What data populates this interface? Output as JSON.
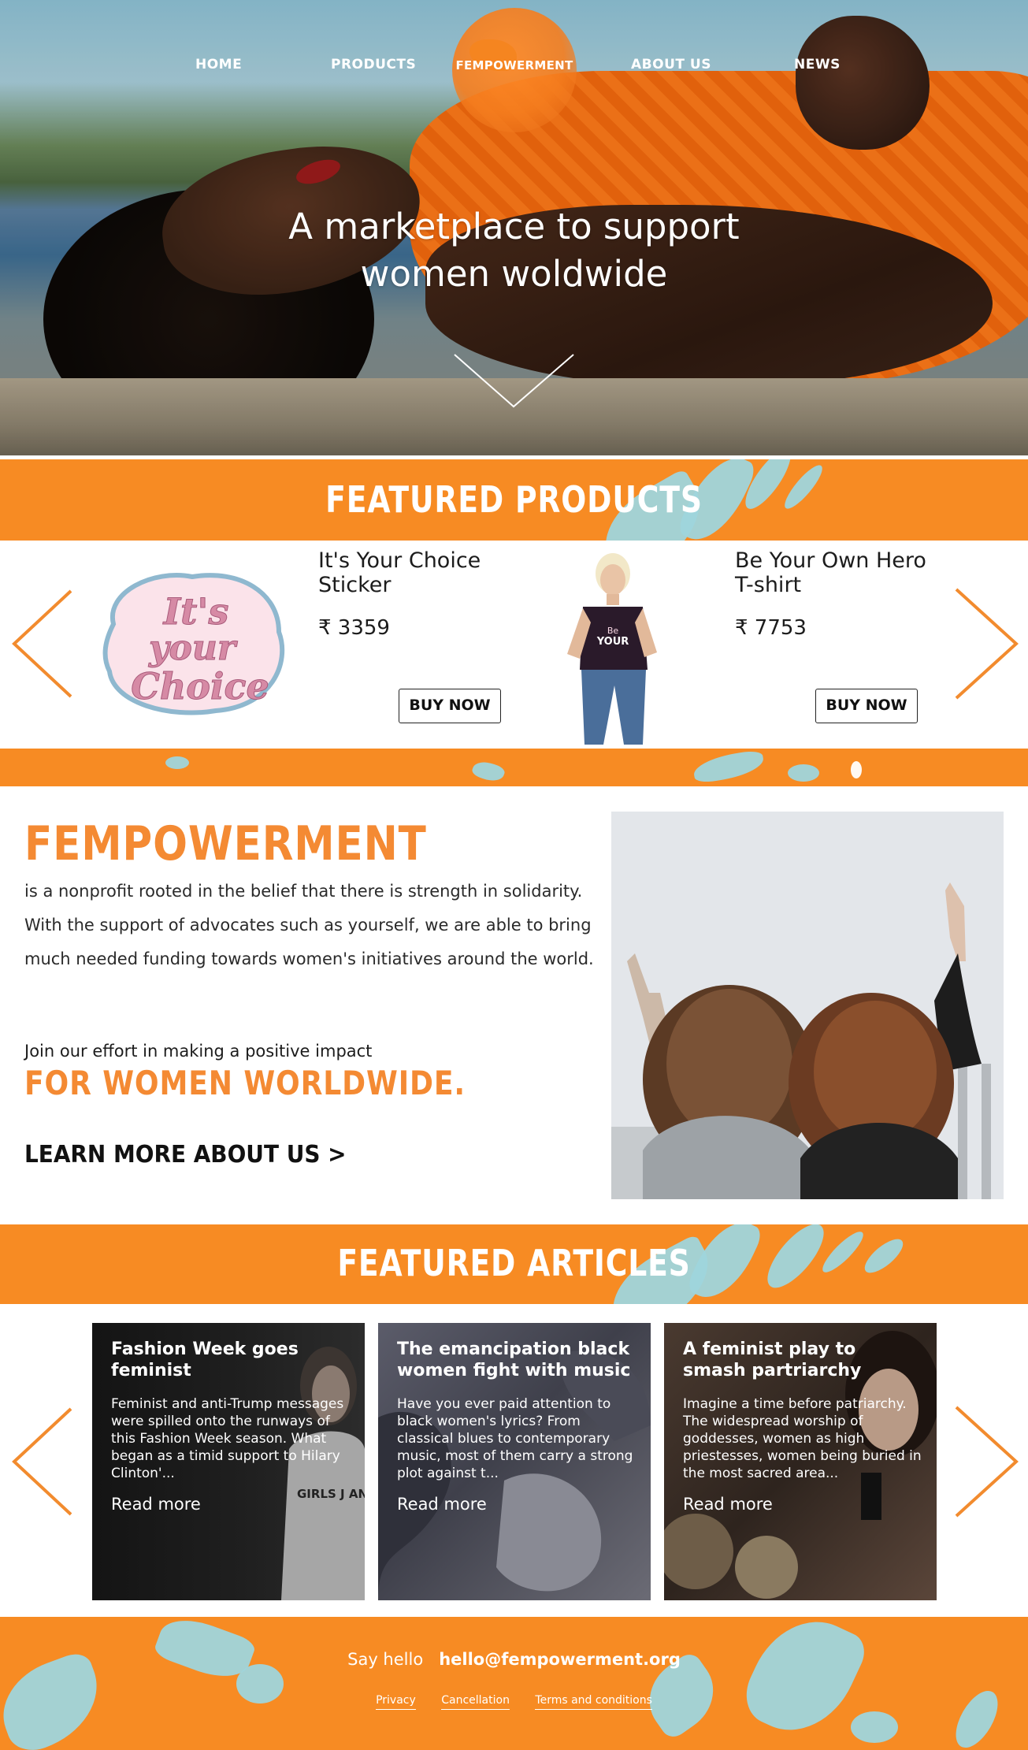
{
  "nav": {
    "home": "HOME",
    "products": "PRODUCTS",
    "logo": "FEMPOWERMENT",
    "about": "ABOUT US",
    "news": "NEWS"
  },
  "hero": {
    "title_line1": "A marketplace to support",
    "title_line2": "women woldwide"
  },
  "featured_products": {
    "title": "FEATURED PRODUCTS",
    "items": [
      {
        "name_line1": "It's Your Choice",
        "name_line2": "Sticker",
        "price": "₹ 3359",
        "button": "BUY NOW",
        "image_text": "It's your Choice"
      },
      {
        "name_line1": "Be Your Own Hero",
        "name_line2": "T-shirt",
        "price": "₹ 7753",
        "button": "BUY NOW"
      }
    ]
  },
  "about": {
    "title": "FEMPOWERMENT",
    "body": "is a nonprofit rooted in the belief that there is strength in solidarity. With the support of advocates such as yourself, we are able to bring much needed funding towards women's initiatives around the world.",
    "join": "Join our effort in making a positive impact",
    "worldwide": "FOR WOMEN WORLDWIDE.",
    "learn_more": "LEARN MORE ABOUT US >"
  },
  "featured_articles": {
    "title": "FEATURED ARTICLES",
    "items": [
      {
        "title": "Fashion Week goes feminist",
        "text": "Feminist and anti-Trump messages were spilled onto the runways of this Fashion Week season. What began as a timid support to Hilary Clinton'...",
        "more": "Read more",
        "shirt_text": "GIRLS J ANT TO FUNDAME RIGHT"
      },
      {
        "title": "The emancipation black women fight with music",
        "text": "Have you ever paid attention to black women's lyrics? From classical blues to contemporary music, most of them carry a strong plot against t...",
        "more": "Read more"
      },
      {
        "title": "A feminist play to smash partriarchy",
        "text": "Imagine a time before patriarchy. The widespread worship of goddesses, women as high priestesses, women being buried in the most sacred area...",
        "more": "Read more"
      }
    ]
  },
  "footer": {
    "say_hello": "Say hello",
    "email": "hello@fempowerment.org",
    "links": [
      "Privacy",
      "Cancellation",
      "Terms and conditions"
    ]
  },
  "colors": {
    "orange": "#f78b23",
    "accent_text": "#f48a33",
    "splash": "#9fd5dc"
  }
}
